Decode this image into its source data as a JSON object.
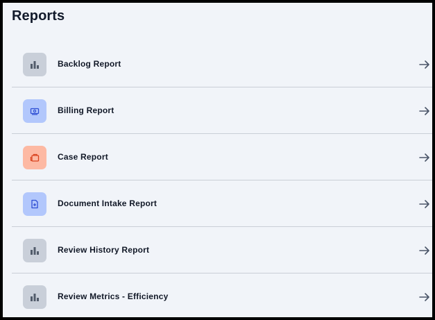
{
  "page": {
    "title": "Reports"
  },
  "colors": {
    "background": "#f1f4f9",
    "title_text": "#121a2b",
    "icon_gray_bg": "#c9cfd9",
    "icon_blue_bg": "#b2c7fc",
    "icon_orange_bg": "#fdb9a3",
    "divider": "#c9ced6",
    "arrow": "#4a5568"
  },
  "reports": [
    {
      "label": "Backlog Report",
      "icon": "bar-chart-icon",
      "icon_color": "gray"
    },
    {
      "label": "Billing Report",
      "icon": "money-bill-icon",
      "icon_color": "blue"
    },
    {
      "label": "Case Report",
      "icon": "briefcase-icon",
      "icon_color": "orange"
    },
    {
      "label": "Document Intake Report",
      "icon": "document-add-icon",
      "icon_color": "blue"
    },
    {
      "label": "Review History Report",
      "icon": "bar-chart-icon",
      "icon_color": "gray"
    },
    {
      "label": "Review Metrics - Efficiency",
      "icon": "bar-chart-icon",
      "icon_color": "gray"
    }
  ]
}
